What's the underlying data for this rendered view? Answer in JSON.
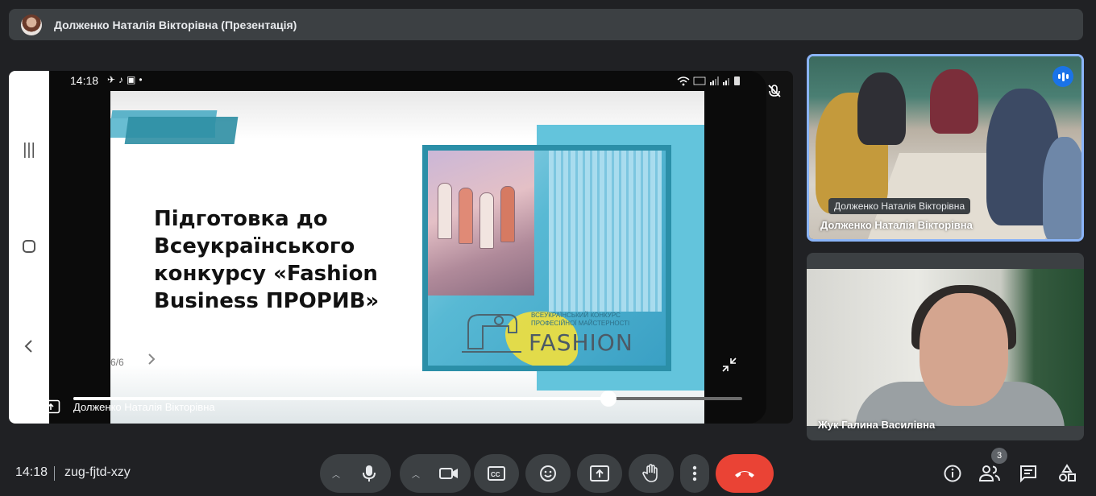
{
  "window": {
    "presenter_title": "Долженко Наталія Вікторівна (Презентація)"
  },
  "stage": {
    "phone_time": "14:18",
    "slide_title": "Підготовка до Всеукраїнського конкурсу «Fashion Business ПРОРИВ»",
    "slide_image_word": "FASHION",
    "slide_image_caption": "ВСЕУКРАЇНСЬКИЙ КОНКУРС ПРОФЕСІЙНОЇ МАЙСТЕРНОСТІ",
    "page_indicator": "6/6",
    "presenter_name": "Долженко Наталія Вікторівна",
    "progress_fraction": 0.8
  },
  "tiles": [
    {
      "name": "Долженко Наталія Вікторівна",
      "tooltip": "Долженко Наталія Вікторівна",
      "speaking": true
    },
    {
      "name": "Жук Галина Василівна",
      "speaking": false
    }
  ],
  "bottom": {
    "clock": "14:18",
    "meeting_code": "zug-fjtd-xzy",
    "participants_count": "3",
    "controls": [
      "microphone",
      "camera",
      "captions",
      "emoji",
      "present-screen",
      "raise-hand",
      "more-options",
      "leave-call"
    ],
    "right_controls": [
      "meeting-details",
      "people",
      "chat",
      "activities"
    ]
  },
  "colors": {
    "background": "#202124",
    "surface": "#3c4043",
    "accent_blue": "#8ab4f8",
    "speaking_blue": "#1a73e8",
    "hangup_red": "#ea4335",
    "slide_teal": "#2b8fa8"
  }
}
